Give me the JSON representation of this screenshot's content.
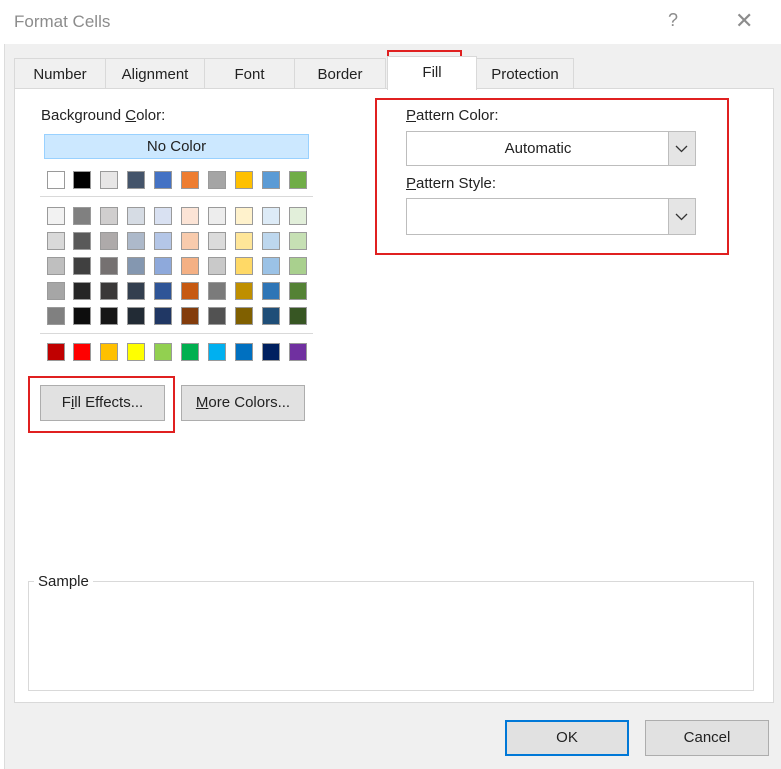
{
  "window": {
    "title": "Format Cells",
    "help_glyph": "?",
    "close_glyph": "✕"
  },
  "tabs": [
    {
      "label": "Number"
    },
    {
      "label": "Alignment"
    },
    {
      "label": "Font"
    },
    {
      "label": "Border"
    },
    {
      "label": "Fill",
      "selected": true
    },
    {
      "label": "Protection"
    }
  ],
  "fill": {
    "background_color_label": {
      "before": "Background ",
      "key": "C",
      "after": "olor:"
    },
    "no_color_label": "No Color",
    "theme_row_top": [
      "#ffffff",
      "#000000",
      "#e7e6e6",
      "#44546a",
      "#4472c4",
      "#ed7d31",
      "#a5a5a5",
      "#ffc000",
      "#5b9bd5",
      "#70ad47"
    ],
    "theme_shades": [
      [
        "#f2f2f2",
        "#808080",
        "#d0cece",
        "#d6dce4",
        "#d9e1f2",
        "#fce4d6",
        "#ededed",
        "#fff2cc",
        "#ddebf7",
        "#e2efda"
      ],
      [
        "#d9d9d9",
        "#595959",
        "#aeaaaa",
        "#adb9ca",
        "#b4c6e7",
        "#f8cbad",
        "#dbdbdb",
        "#ffe699",
        "#bdd7ee",
        "#c6e0b4"
      ],
      [
        "#bfbfbf",
        "#404040",
        "#757171",
        "#8497b0",
        "#8ea9db",
        "#f4b084",
        "#c9c9c9",
        "#ffd966",
        "#9bc2e6",
        "#a9d08e"
      ],
      [
        "#a6a6a6",
        "#262626",
        "#3a3838",
        "#333f4f",
        "#2f5597",
        "#c65911",
        "#7b7b7b",
        "#bf8f00",
        "#2e75b6",
        "#548235"
      ],
      [
        "#808080",
        "#0d0d0d",
        "#161616",
        "#222b35",
        "#203764",
        "#833c0c",
        "#525252",
        "#806000",
        "#1f4e78",
        "#375623"
      ]
    ],
    "standard_colors": [
      "#c00000",
      "#ff0000",
      "#ffc000",
      "#ffff00",
      "#92d050",
      "#00b050",
      "#00b0f0",
      "#0070c0",
      "#002060",
      "#7030a0"
    ],
    "fill_effects_button": {
      "key": "i",
      "before": "F",
      "after": "ll Effects..."
    },
    "more_colors_button": {
      "key": "M",
      "before": "",
      "after": "ore Colors..."
    },
    "pattern_color_label": {
      "key": "P",
      "before": "",
      "after": "attern Color:"
    },
    "pattern_color_value": "Automatic",
    "pattern_style_label": {
      "key": "P",
      "before": "",
      "after": "attern Style:"
    },
    "pattern_style_value": "",
    "sample_label": "Sample"
  },
  "footer": {
    "ok_label": "OK",
    "cancel_label": "Cancel"
  },
  "colors": {
    "highlight": "#e02020",
    "selection_fill": "#cce8ff",
    "accent_border": "#0078d7"
  }
}
